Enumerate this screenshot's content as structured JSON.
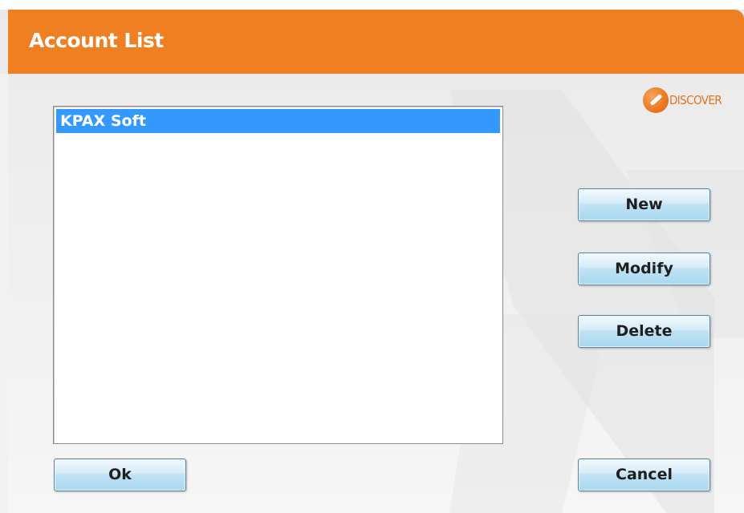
{
  "window": {
    "title": "Account List"
  },
  "logo": {
    "icon": "discover-logo-icon",
    "text": "DISCOVER"
  },
  "account_list": {
    "items": [
      {
        "label": "KPAX Soft",
        "selected": true
      }
    ]
  },
  "buttons": {
    "new_label": "New",
    "modify_label": "Modify",
    "delete_label": "Delete",
    "ok_label": "Ok",
    "cancel_label": "Cancel"
  },
  "colors": {
    "title_bar": "#f07f22",
    "selection": "#3399ff",
    "button_face": "#bfe2f4",
    "background": "#efefef"
  }
}
